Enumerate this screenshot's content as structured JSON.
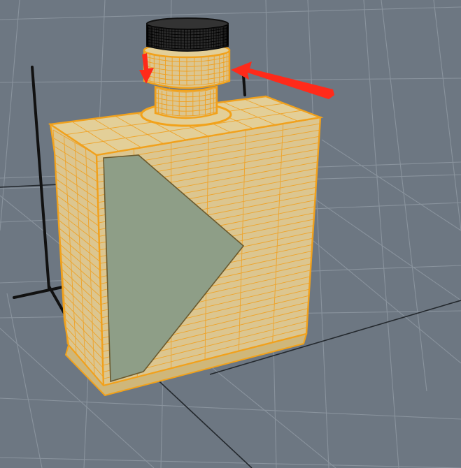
{
  "viewport": {
    "view": "perspective",
    "background_color": "#6d7782",
    "grid_color": "#8a939d",
    "grid_axis_color": "#2c3136"
  },
  "model": {
    "object": "bottle",
    "display_mode": "wireframe-on-shaded",
    "selected": true,
    "selection_color": "#f2a21a",
    "face_color": "#d8c58f",
    "decal_color": "#8a9a84",
    "cap_color": "#1a1a1a"
  },
  "annotations": [
    {
      "type": "arrow",
      "color": "#ff2a1a",
      "points_to": "bottle-neck-ring"
    },
    {
      "type": "arrow",
      "color": "#ff2a1a",
      "points_to": "bottle-neck-ring"
    }
  ]
}
